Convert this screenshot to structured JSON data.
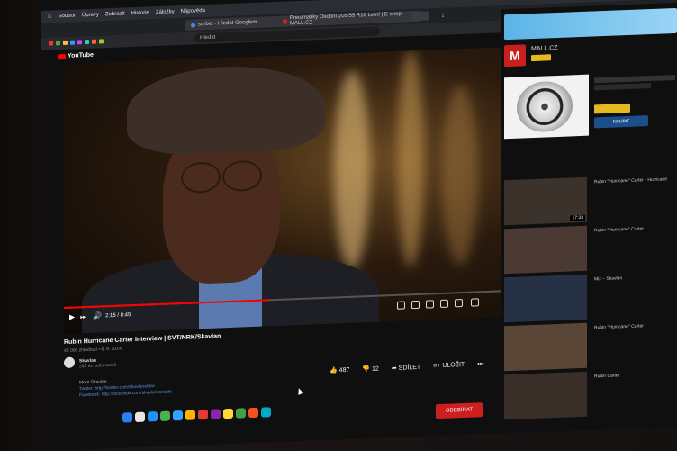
{
  "menubar": {
    "items": [
      "Soubor",
      "Úpravy",
      "Zobrazit",
      "Historie",
      "Záložky",
      "Nápověda"
    ]
  },
  "tabs": [
    {
      "label": "sorbet - Hledat Googlem"
    },
    {
      "label": "Pneumatiky Osobní 205/55 R16 Letní | E-shop MALL.CZ"
    }
  ],
  "addressbar": {
    "placeholder": "Hledat"
  },
  "youtube": {
    "logo": "YouTube",
    "player": {
      "time": "2:15 / 8:45",
      "progress_fraction": 0.47
    },
    "video": {
      "title": "Rubin Hurricane Carter Interview | SVT/NRK/Skavlan",
      "meta": "45 000 zhlédnutí • 6. 9. 2014",
      "channel_name": "Skavlan",
      "channel_subs": "285 tis. odběratelů",
      "description": [
        "More Skavlan",
        "Twitter: http://twitter.com/skavlanshow",
        "Facebook: http://facebook.com/skavlanfanside"
      ],
      "likes": "487",
      "dislikes": "12",
      "share_label": "SDÍLET",
      "save_label": "ULOŽIT",
      "more_label": "•••",
      "subscribe_label": "ODEBÍRAT"
    }
  },
  "sidebar": {
    "ad": {
      "brand_logo": "M",
      "brand_name": "MALL.CZ",
      "promo_button": "KOUPIT"
    },
    "recommendations": [
      {
        "title": "Rubin \"Hurricane\" Carter - Hurricane",
        "duration": "17:33"
      },
      {
        "title": "Rubin \"Hurricane\" Carter",
        "duration": ""
      },
      {
        "title": "Mix – Skavlan",
        "duration": ""
      },
      {
        "title": "Rubin \"Hurricane\" Carter",
        "duration": ""
      },
      {
        "title": "Rubin Carter",
        "duration": ""
      }
    ]
  },
  "colors": {
    "youtube_red": "#ff0000",
    "subscribe_red": "#cc1f1f",
    "mall_red": "#c9201f",
    "link_blue": "#5a8fd6"
  }
}
